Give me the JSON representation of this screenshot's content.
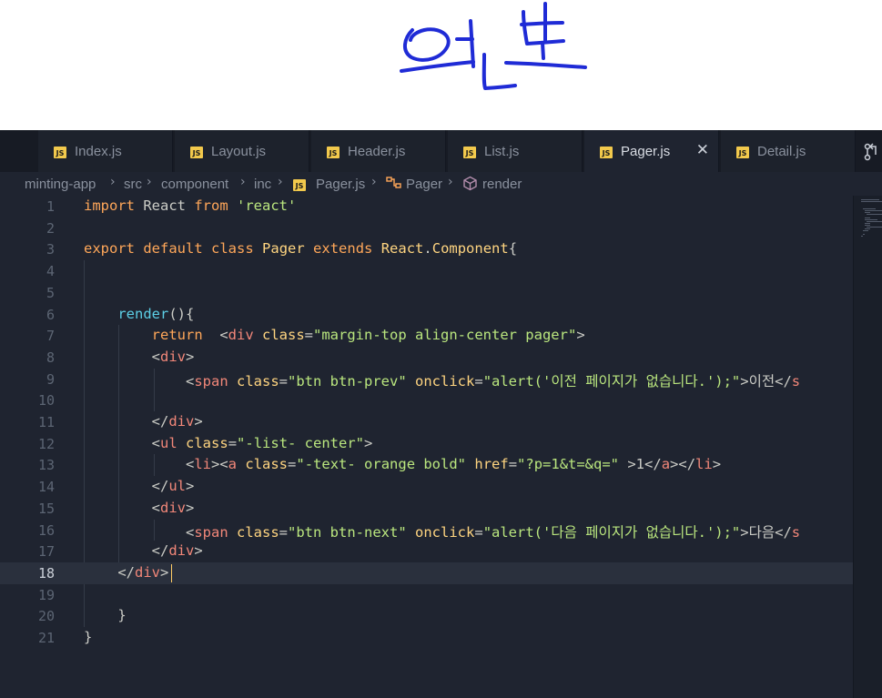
{
  "annotation": {
    "handwriting_text": "원본",
    "ink_color": "#1f2bd6"
  },
  "tabs": [
    {
      "label": "Index.js",
      "icon": "js-file-icon",
      "active": false
    },
    {
      "label": "Layout.js",
      "icon": "js-file-icon",
      "active": false
    },
    {
      "label": "Header.js",
      "icon": "js-file-icon",
      "active": false
    },
    {
      "label": "List.js",
      "icon": "js-file-icon",
      "active": false
    },
    {
      "label": "Pager.js",
      "icon": "js-file-icon",
      "active": true,
      "close": "✕"
    },
    {
      "label": "Detail.js",
      "icon": "js-file-icon",
      "active": false
    }
  ],
  "breadcrumb": {
    "items": [
      "minting-app",
      "src",
      "component",
      "inc",
      "Pager.js",
      "Pager",
      "render"
    ],
    "separator": "›"
  },
  "editor": {
    "current_line": 18,
    "lines": [
      {
        "n": "1",
        "tokens": [
          [
            "kw",
            "import"
          ],
          [
            "pun",
            " React "
          ],
          [
            "kw",
            "from"
          ],
          [
            "pun",
            " "
          ],
          [
            "str",
            "'react'"
          ]
        ]
      },
      {
        "n": "2",
        "tokens": []
      },
      {
        "n": "3",
        "tokens": [
          [
            "kw",
            "export"
          ],
          [
            "pun",
            " "
          ],
          [
            "kw",
            "default"
          ],
          [
            "pun",
            " "
          ],
          [
            "kw",
            "class"
          ],
          [
            "pun",
            " "
          ],
          [
            "cls",
            "Pager"
          ],
          [
            "pun",
            " "
          ],
          [
            "kw",
            "extends"
          ],
          [
            "pun",
            " "
          ],
          [
            "cls",
            "React"
          ],
          [
            "pun",
            "."
          ],
          [
            "cls",
            "Component"
          ],
          [
            "pun",
            "{"
          ]
        ]
      },
      {
        "n": "4",
        "tokens": []
      },
      {
        "n": "5",
        "tokens": []
      },
      {
        "n": "6",
        "tokens": [
          [
            "pun",
            "    "
          ],
          [
            "fn",
            "render"
          ],
          [
            "pun",
            "(){"
          ]
        ]
      },
      {
        "n": "7",
        "tokens": [
          [
            "pun",
            "        "
          ],
          [
            "kw",
            "return"
          ],
          [
            "pun",
            "  <"
          ],
          [
            "tag",
            "div"
          ],
          [
            "pun",
            " "
          ],
          [
            "attr",
            "class"
          ],
          [
            "pun",
            "="
          ],
          [
            "str",
            "\"margin-top align-center pager\""
          ],
          [
            "pun",
            ">"
          ]
        ]
      },
      {
        "n": "8",
        "tokens": [
          [
            "pun",
            "        <"
          ],
          [
            "tag",
            "div"
          ],
          [
            "pun",
            ">"
          ]
        ]
      },
      {
        "n": "9",
        "tokens": [
          [
            "pun",
            "            <"
          ],
          [
            "tag",
            "span"
          ],
          [
            "pun",
            " "
          ],
          [
            "attr",
            "class"
          ],
          [
            "pun",
            "="
          ],
          [
            "str",
            "\"btn btn-prev\""
          ],
          [
            "pun",
            " "
          ],
          [
            "attr",
            "onclick"
          ],
          [
            "pun",
            "="
          ],
          [
            "str",
            "\"alert('이전 페이지가 없습니다.');\""
          ],
          [
            "pun",
            ">이전</"
          ],
          [
            "tag",
            "s"
          ]
        ]
      },
      {
        "n": "10",
        "tokens": []
      },
      {
        "n": "11",
        "tokens": [
          [
            "pun",
            "        </"
          ],
          [
            "tag",
            "div"
          ],
          [
            "pun",
            ">"
          ]
        ]
      },
      {
        "n": "12",
        "tokens": [
          [
            "pun",
            "        <"
          ],
          [
            "tag",
            "ul"
          ],
          [
            "pun",
            " "
          ],
          [
            "attr",
            "class"
          ],
          [
            "pun",
            "="
          ],
          [
            "str",
            "\"-list- center\""
          ],
          [
            "pun",
            ">"
          ]
        ]
      },
      {
        "n": "13",
        "tokens": [
          [
            "pun",
            "            <"
          ],
          [
            "tag",
            "li"
          ],
          [
            "pun",
            "><"
          ],
          [
            "tag",
            "a"
          ],
          [
            "pun",
            " "
          ],
          [
            "attr",
            "class"
          ],
          [
            "pun",
            "="
          ],
          [
            "str",
            "\"-text- orange bold\""
          ],
          [
            "pun",
            " "
          ],
          [
            "attr",
            "href"
          ],
          [
            "pun",
            "="
          ],
          [
            "str",
            "\"?p=1&t=&q=\""
          ],
          [
            "pun",
            " >1</"
          ],
          [
            "tag",
            "a"
          ],
          [
            "pun",
            "></"
          ],
          [
            "tag",
            "li"
          ],
          [
            "pun",
            ">"
          ]
        ]
      },
      {
        "n": "14",
        "tokens": [
          [
            "pun",
            "        </"
          ],
          [
            "tag",
            "ul"
          ],
          [
            "pun",
            ">"
          ]
        ]
      },
      {
        "n": "15",
        "tokens": [
          [
            "pun",
            "        <"
          ],
          [
            "tag",
            "div"
          ],
          [
            "pun",
            ">"
          ]
        ]
      },
      {
        "n": "16",
        "tokens": [
          [
            "pun",
            "            <"
          ],
          [
            "tag",
            "span"
          ],
          [
            "pun",
            " "
          ],
          [
            "attr",
            "class"
          ],
          [
            "pun",
            "="
          ],
          [
            "str",
            "\"btn btn-next\""
          ],
          [
            "pun",
            " "
          ],
          [
            "attr",
            "onclick"
          ],
          [
            "pun",
            "="
          ],
          [
            "str",
            "\"alert('다음 페이지가 없습니다.');\""
          ],
          [
            "pun",
            ">다음</"
          ],
          [
            "tag",
            "s"
          ]
        ]
      },
      {
        "n": "17",
        "tokens": [
          [
            "pun",
            "        </"
          ],
          [
            "tag",
            "div"
          ],
          [
            "pun",
            ">"
          ]
        ]
      },
      {
        "n": "18",
        "tokens": [
          [
            "pun",
            "    </"
          ],
          [
            "tag",
            "div"
          ],
          [
            "pun",
            ">"
          ]
        ]
      },
      {
        "n": "19",
        "tokens": []
      },
      {
        "n": "20",
        "tokens": [
          [
            "pun",
            "    }"
          ]
        ]
      },
      {
        "n": "21",
        "tokens": [
          [
            "pun",
            "}"
          ]
        ]
      }
    ]
  },
  "colors": {
    "editor_bg": "#1f2430",
    "keyword": "#ffa759",
    "string": "#bae67e",
    "tag": "#f28779",
    "function": "#5ccfe6",
    "class": "#ffd580"
  }
}
